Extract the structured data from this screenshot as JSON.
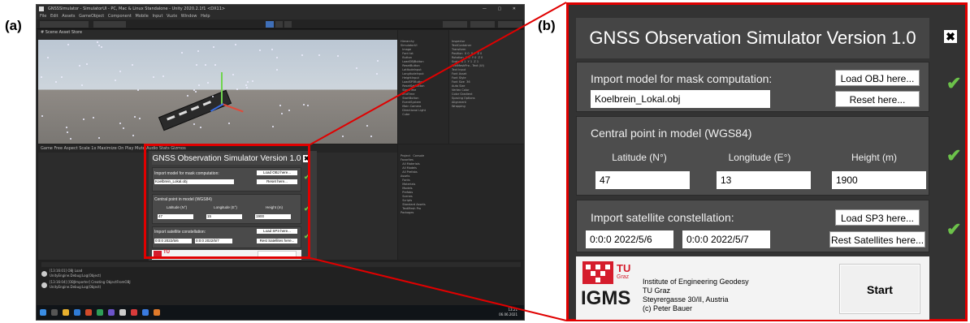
{
  "labels": {
    "a": "(a)",
    "b": "(b)"
  },
  "unity": {
    "window_title": "GNSSSimulator - SimulatorUI - PC, Mac & Linux Standalone - Unity 2020.2.1f1 <DX11>",
    "menu": "File  Edit  Assets  GameObject  Component  Mobile Input  Vuzix  Window  Help",
    "scene_tab": "# Scene    Asset Store",
    "game_tab": "Game   Free Aspect   Scale 1x   Maximize On Play   Mute Audio   Stats   Gizmos",
    "hierarchy_text": "Hierarchy\nSimulatorUI\n  Image\n  Font txt\n  Button\n  LoadOBJButton\n  ResetButton\n  LatitudeInput\n  LongitudeInput\n  HeightInput\n  LoadSP3Button\n  ResetSatButton\n  StartTime\n  EndTime\n  StartButton\n  EventSystem\n  Main Camera\n  Directional Light\n  Cube",
    "inspector_text": "Inspector\nTextContainer\nTransform\nPosition  X 0  Y 0  Z 0\nRotation  X 0  Y 0  Z 0\nScale  X 1  Y 1  Z 1\nTextMeshPro - Text (UI)\nText Input\nFont Asset\nFont Style\nFont Size  36\nAuto Size\nVertex Color\nColor Gradient\nSpacing Options\nAlignment\nWrapping",
    "project_text": "Project   Console\nFavorites\n  All Materials\n  All Models\n  All Prefabs\nAssets\n  Fonts\n  Materials\n  Models\n  Prefabs\n  Scenes\n  Scripts\n  Standard Assets\n  TextMesh Pro\nPackages",
    "console_lines": [
      "[13:16:01] OBJ Load\nUnityEngine.Debug:Log(Object)",
      "[13:16:04] [OBJImporter] Creating ObjectFromOBJ\nUnityEngine.Debug:Log(Object)"
    ],
    "clock": "13:21\n06.06.2021",
    "mini": {
      "title": "GNSS Observation Simulator Version 1.0",
      "close": "✖",
      "s1_title": "Import model for mask computation:",
      "s1_btn1": "Load OBJ here...",
      "s1_btn2": "Reset here...",
      "s1_file": "Koelbrein_Lokal.obj",
      "s2_title": "Central point in model (WGS84)",
      "s2_lat": "Latitude (N°)",
      "s2_lon": "Longitude (E°)",
      "s2_h": "Height (m)",
      "s2_lat_v": "47",
      "s2_lon_v": "15",
      "s2_h_v": "1900",
      "s3_title": "Import satellite constellation:",
      "s3_btn1": "Load SP3 here...",
      "s3_btn2": "Rest Satellites here...",
      "s3_start": "0:0:0   2022/5/6",
      "s3_end": "0:0:0   2022/5/7",
      "tu": "TU"
    }
  },
  "panel": {
    "title": "GNSS Observation Simulator Version 1.0",
    "close_glyph": "✖",
    "check_glyph": "✔",
    "import_model": {
      "title": "Import model for mask computation:",
      "load_button": "Load OBJ here...",
      "reset_button": "Reset here...",
      "file_value": "Koelbrein_Lokal.obj"
    },
    "central_point": {
      "title": "Central point in model (WGS84)",
      "lat_label": "Latitude (N°)",
      "lon_label": "Longitude (E°)",
      "height_label": "Height (m)",
      "lat_value": "47",
      "lon_value": "13",
      "height_value": "1900"
    },
    "constellation": {
      "title": "Import satellite constellation:",
      "load_button": "Load SP3 here...",
      "reset_button": "Rest Satellites here...",
      "start_value": "0:0:0   2022/5/6",
      "end_value": "0:0:0   2022/5/7"
    },
    "footer": {
      "logo_tu": "TU",
      "logo_graz": "Graz",
      "logo_igms": "IGMS",
      "institute_lines": [
        "Institute of Engineering Geodesy",
        "TU Graz",
        "Steyrergasse 30/II, Austria",
        "(c) Peter Bauer"
      ],
      "start_button": "Start"
    },
    "colors": {
      "frame": "#e00000",
      "check": "#6cc24a",
      "tu_red": "#d51c2c"
    }
  }
}
